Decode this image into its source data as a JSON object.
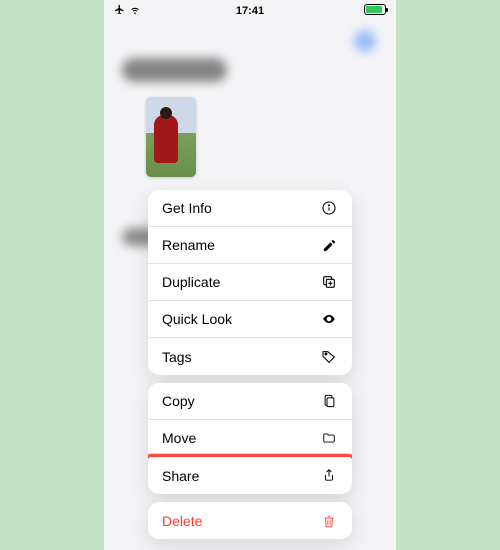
{
  "status": {
    "time": "17:41"
  },
  "menu": {
    "group1": [
      {
        "label": "Get Info",
        "icon": "info-icon"
      },
      {
        "label": "Rename",
        "icon": "pencil-icon"
      },
      {
        "label": "Duplicate",
        "icon": "duplicate-icon"
      },
      {
        "label": "Quick Look",
        "icon": "eye-icon"
      },
      {
        "label": "Tags",
        "icon": "tag-icon"
      }
    ],
    "group2": [
      {
        "label": "Copy",
        "icon": "copy-icon"
      },
      {
        "label": "Move",
        "icon": "folder-icon"
      },
      {
        "label": "Share",
        "icon": "share-icon",
        "highlighted": true
      }
    ],
    "group3": [
      {
        "label": "Delete",
        "icon": "trash-icon",
        "destructive": true
      }
    ]
  },
  "colors": {
    "destructive": "#ff3b30",
    "highlight": "#ff4b3e",
    "battery": "#34c759"
  }
}
